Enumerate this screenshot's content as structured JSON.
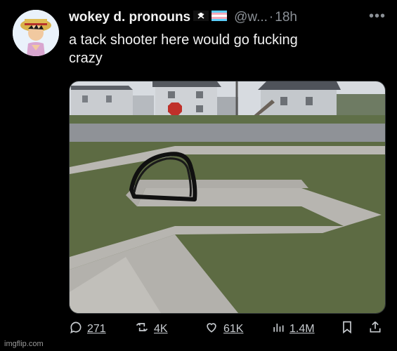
{
  "post": {
    "display_name": "wokey d. pronouns",
    "handle": "@w...",
    "separator": "·",
    "time": "18h",
    "more_icon": "more-horizontal-icon",
    "text_line1": "a tack shooter here would go fucking",
    "text_line2": "crazy"
  },
  "actions": {
    "replies": "271",
    "reposts": "4K",
    "likes": "61K",
    "views": "1.4M"
  },
  "icons": {
    "reply": "reply-icon",
    "repost": "repost-icon",
    "like": "heart-icon",
    "views": "views-icon",
    "bookmark": "bookmark-icon",
    "share": "share-icon"
  },
  "watermark": "imgflip.com",
  "colors": {
    "background": "#000000",
    "text": "#e7e9ea",
    "muted": "#8b9096"
  }
}
